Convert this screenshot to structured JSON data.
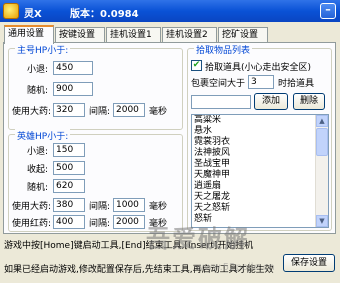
{
  "window": {
    "title": "灵X",
    "version": "版本：0.0984",
    "minimize": "–"
  },
  "tabs": [
    "通用设置",
    "按键设置",
    "挂机设置1",
    "挂机设置2",
    "挖矿设置"
  ],
  "mp_group": {
    "title": "主号HP小于:",
    "fields": [
      {
        "label": "小退:",
        "value": "450"
      },
      {
        "label": "随机:",
        "value": "900"
      }
    ],
    "potion": {
      "label": "使用大药:",
      "value": "320",
      "interval_label": "间隔:",
      "interval": "2000",
      "unit": "毫秒"
    }
  },
  "hero_group": {
    "title": "英雄HP小于:",
    "fields": [
      {
        "label": "小退:",
        "value": "150"
      },
      {
        "label": "收起:",
        "value": "500"
      },
      {
        "label": "随机:",
        "value": "620"
      }
    ],
    "potion_big": {
      "label": "使用大药:",
      "value": "380",
      "interval_label": "间隔:",
      "interval": "1000",
      "unit": "毫秒"
    },
    "potion_red": {
      "label": "使用红药:",
      "value": "400",
      "interval_label": "间隔:",
      "interval": "2000",
      "unit": "毫秒"
    }
  },
  "pickup": {
    "title": "拾取物品列表",
    "checkbox_label": "拾取道具(小心走出安全区)",
    "checked": "✔",
    "bag_label": "包裹空间大于",
    "bag_value": "3",
    "bag_suffix": "时拾道具",
    "new_item_value": "",
    "add_button": "添加",
    "delete_button": "删除",
    "items": [
      "高粱米",
      "悬水",
      "霓裳羽衣",
      "法神披风",
      "圣战宝甲",
      "天魔神甲",
      "逍遥扇",
      "天之屠龙",
      "天之怒斩",
      "怒斩"
    ]
  },
  "footer": {
    "line1": "游戏中按[Home]键启动工具,[End]结束工具,[Insert]开始挂机",
    "line2": "如果已经启动游戏,修改配置保存后,先结束工具,再启动工具才能生效",
    "save_button": "保存设置"
  },
  "watermark": {
    "text": "吾爱破解",
    "url": "www.52pojie.cn"
  }
}
